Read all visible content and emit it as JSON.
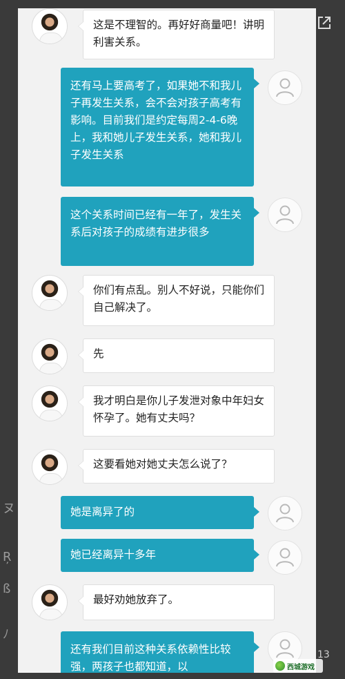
{
  "messages": [
    {
      "from": "doctor",
      "text": "这是不理智的。再好好商量吧！讲明利害关系。"
    },
    {
      "from": "user",
      "text": "还有马上要高考了，如果她不和我儿子再发生关系，会不会对孩子高考有影响。目前我们是约定每周2-4-6晚上，我和她儿子发生关系，她和我儿子发生关系"
    },
    {
      "from": "user",
      "text": "这个关系时间已经有一年了，发生关系后对孩子的成绩有进步很多"
    },
    {
      "from": "doctor",
      "text": "你们有点乱。别人不好说，只能你们自己解决了。"
    },
    {
      "from": "doctor",
      "text": "先"
    },
    {
      "from": "doctor",
      "text": "我才明白是你儿子发泄对象中年妇女怀孕了。她有丈夫吗？"
    },
    {
      "from": "doctor",
      "text": "这要看她对她丈夫怎么说了？"
    },
    {
      "from": "user",
      "text": "她是离异了的"
    },
    {
      "from": "user",
      "text": "她已经离异十多年"
    },
    {
      "from": "doctor",
      "text": "最好劝她放弃了。"
    },
    {
      "from": "user",
      "text": "还有我们目前这种关系依赖性比较强，两孩子也都知道，以"
    }
  ],
  "edge": {
    "page_number": "13",
    "glyph_a": "ヌ",
    "glyph_b": "Ŗ",
    "glyph_c": "ß",
    "glyph_d": "ﾉ"
  },
  "watermark": {
    "text": "西城游戏"
  },
  "icons": {
    "share": "external-link-icon",
    "doctor": "doctor-avatar",
    "user": "user-avatar-icon"
  },
  "colors": {
    "right_bubble": "#20a2bd",
    "left_bubble": "#ffffff",
    "background": "#f2f2f2"
  }
}
